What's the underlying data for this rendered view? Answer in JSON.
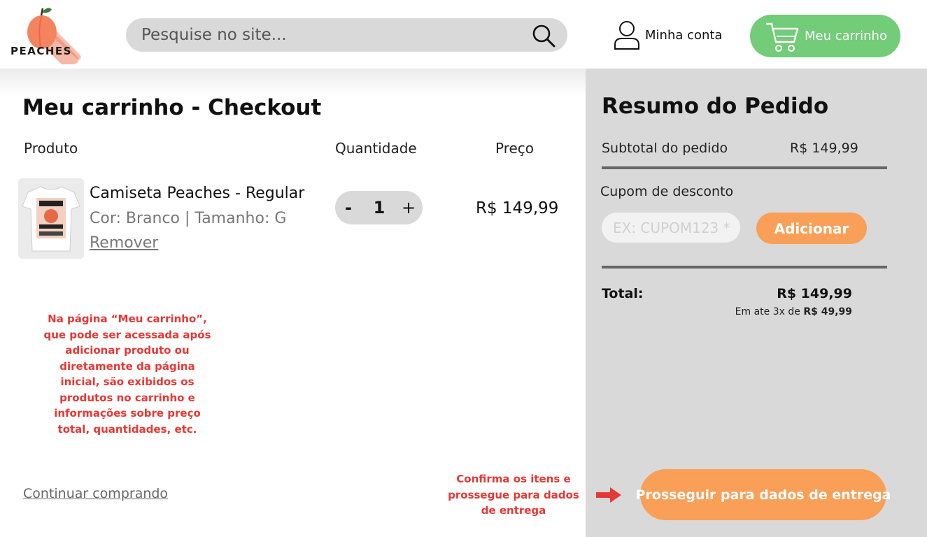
{
  "header": {
    "logo_text": "PEACHES",
    "search_placeholder": "Pesquise no site...",
    "account_label": "Minha conta",
    "cart_label": "Meu carrinho"
  },
  "main": {
    "title": "Meu carrinho - Checkout",
    "columns": {
      "product": "Produto",
      "quantity": "Quantidade",
      "price": "Preço"
    },
    "item": {
      "name": "Camiseta Peaches - Regular",
      "variant": "Cor: Branco | Tamanho: G",
      "remove_label": "Remover",
      "qty_minus": "-",
      "quantity": "1",
      "qty_plus": "+",
      "price": "R$ 149,99"
    },
    "continue_label": "Continuar comprando"
  },
  "summary": {
    "title": "Resumo do Pedido",
    "subtotal_label": "Subtotal do pedido",
    "subtotal_value": "R$ 149,99",
    "coupon_label": "Cupom de desconto",
    "coupon_placeholder": "EX: CUPOM123 *",
    "add_button": "Adicionar",
    "total_label": "Total:",
    "total_value": "R$ 149,99",
    "installments_prefix": "Em ate 3x de ",
    "installments_value": "R$ 49,99",
    "proceed_button": "Prosseguir para dados de entrega"
  },
  "annotations": {
    "cart_note": "Na página “Meu carrinho”, que pode ser acessada após adicionar produto ou diretamente da página inicial, são exibidos os produtos no carrinho e informações sobre preço total, quantidades, etc.",
    "proceed_note": "Confirma os itens e prossegue para dados de entrega"
  },
  "colors": {
    "cart_green": "#72cc78",
    "accent_orange": "#f99f57",
    "panel_gray": "#d9d9d9",
    "annotation_red": "#e53935"
  },
  "icons": [
    "peach-logo-icon",
    "search-icon",
    "user-icon",
    "cart-icon",
    "arrow-right-icon"
  ]
}
